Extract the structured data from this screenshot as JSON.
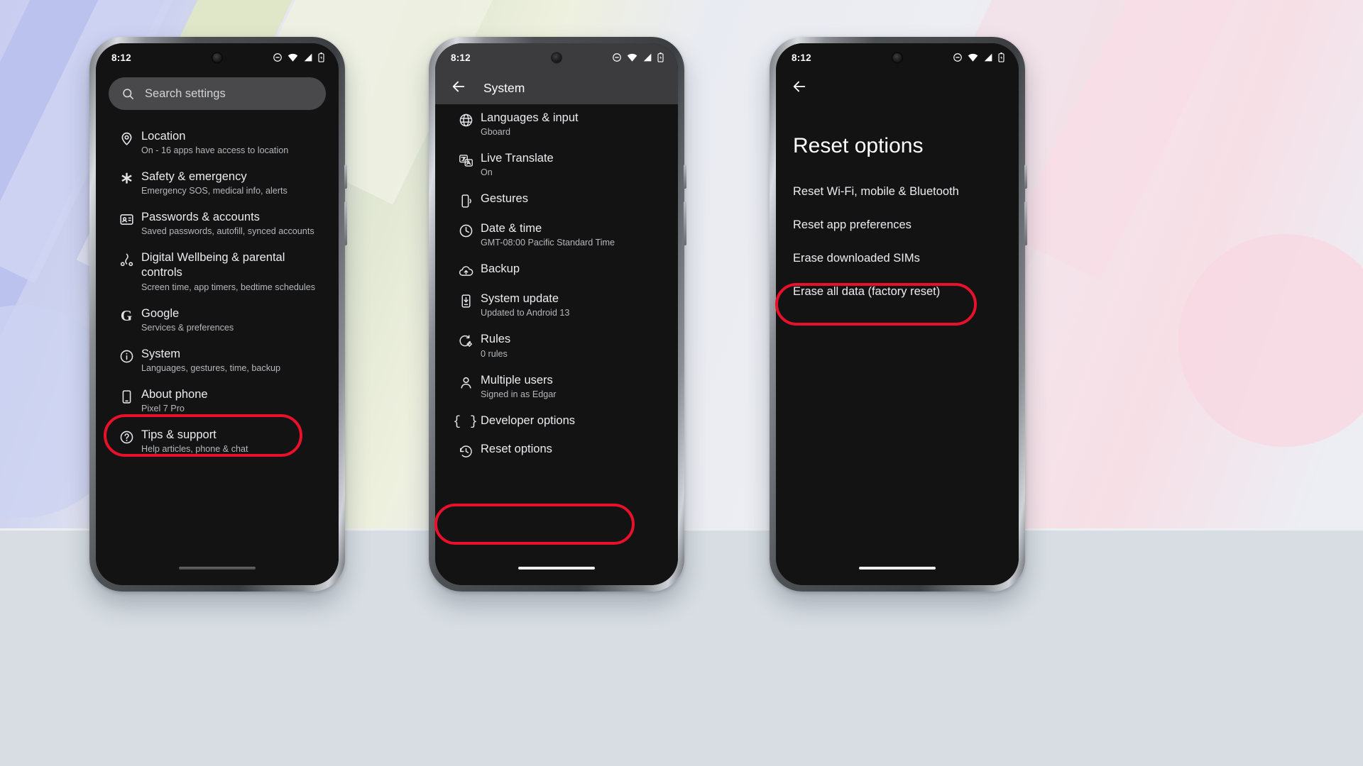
{
  "background": {
    "top_color": "#e8eaf0",
    "bottom_color": "#d7dde3",
    "accent_lavender": "#c9cdf0",
    "accent_green": "#dfe7c6",
    "accent_pink": "#f7d9e3"
  },
  "annotation": {
    "color": "#e8102a",
    "shape": "ellipse-outline"
  },
  "phones": [
    {
      "id": "phone-settings-root",
      "status": {
        "time": "8:12",
        "icons": [
          "do-not-disturb-icon",
          "wifi-icon",
          "signal-icon",
          "battery-charging-icon"
        ]
      },
      "search": {
        "placeholder": "Search settings",
        "icon": "search-icon"
      },
      "partial_row_above": "",
      "items": [
        {
          "icon": "location-pin-icon",
          "title": "Location",
          "sub": "On - 16 apps have access to location",
          "highlighted": false
        },
        {
          "icon": "asterisk-icon",
          "title": "Safety & emergency",
          "sub": "Emergency SOS, medical info, alerts",
          "highlighted": false
        },
        {
          "icon": "passwords-icon",
          "title": "Passwords & accounts",
          "sub": "Saved passwords, autofill, synced accounts",
          "highlighted": false
        },
        {
          "icon": "wellbeing-icon",
          "title": "Digital Wellbeing & parental controls",
          "sub": "Screen time, app timers, bedtime schedules",
          "highlighted": false
        },
        {
          "icon": "google-g-icon",
          "title": "Google",
          "sub": "Services & preferences",
          "highlighted": false
        },
        {
          "icon": "info-circle-icon",
          "title": "System",
          "sub": "Languages, gestures, time, backup",
          "highlighted": true
        },
        {
          "icon": "phone-device-icon",
          "title": "About phone",
          "sub": "Pixel 7 Pro",
          "highlighted": false
        },
        {
          "icon": "help-circle-icon",
          "title": "Tips & support",
          "sub": "Help articles, phone & chat",
          "highlighted": false
        }
      ]
    },
    {
      "id": "phone-system",
      "status": {
        "time": "8:12",
        "icons": [
          "do-not-disturb-icon",
          "wifi-icon",
          "signal-icon",
          "battery-charging-icon"
        ]
      },
      "toolbar": {
        "back_icon": "back-arrow-icon",
        "title": "System"
      },
      "items": [
        {
          "icon": "globe-icon",
          "title": "Languages & input",
          "sub": "Gboard",
          "highlighted": false
        },
        {
          "icon": "live-translate-icon",
          "title": "Live Translate",
          "sub": "On",
          "highlighted": false
        },
        {
          "icon": "gestures-icon",
          "title": "Gestures",
          "sub": "",
          "highlighted": false
        },
        {
          "icon": "clock-icon",
          "title": "Date & time",
          "sub": "GMT-08:00 Pacific Standard Time",
          "highlighted": false
        },
        {
          "icon": "cloud-upload-icon",
          "title": "Backup",
          "sub": "",
          "highlighted": false
        },
        {
          "icon": "system-update-icon",
          "title": "System update",
          "sub": "Updated to Android 13",
          "highlighted": false
        },
        {
          "icon": "rules-icon",
          "title": "Rules",
          "sub": "0 rules",
          "highlighted": false
        },
        {
          "icon": "person-icon",
          "title": "Multiple users",
          "sub": "Signed in as Edgar",
          "highlighted": false
        },
        {
          "icon": "braces-icon",
          "title": "Developer options",
          "sub": "",
          "highlighted": false
        },
        {
          "icon": "history-reset-icon",
          "title": "Reset options",
          "sub": "",
          "highlighted": true
        }
      ]
    },
    {
      "id": "phone-reset-options",
      "status": {
        "time": "8:12",
        "icons": [
          "do-not-disturb-icon",
          "wifi-icon",
          "signal-icon",
          "battery-charging-icon"
        ]
      },
      "toolbar": {
        "back_icon": "back-arrow-icon",
        "title": ""
      },
      "page_title": "Reset options",
      "items": [
        {
          "title": "Reset Wi-Fi, mobile & Bluetooth",
          "highlighted": false
        },
        {
          "title": "Reset app preferences",
          "highlighted": false
        },
        {
          "title": "Erase downloaded SIMs",
          "highlighted": false
        },
        {
          "title": "Erase all data (factory reset)",
          "highlighted": true
        }
      ]
    }
  ]
}
